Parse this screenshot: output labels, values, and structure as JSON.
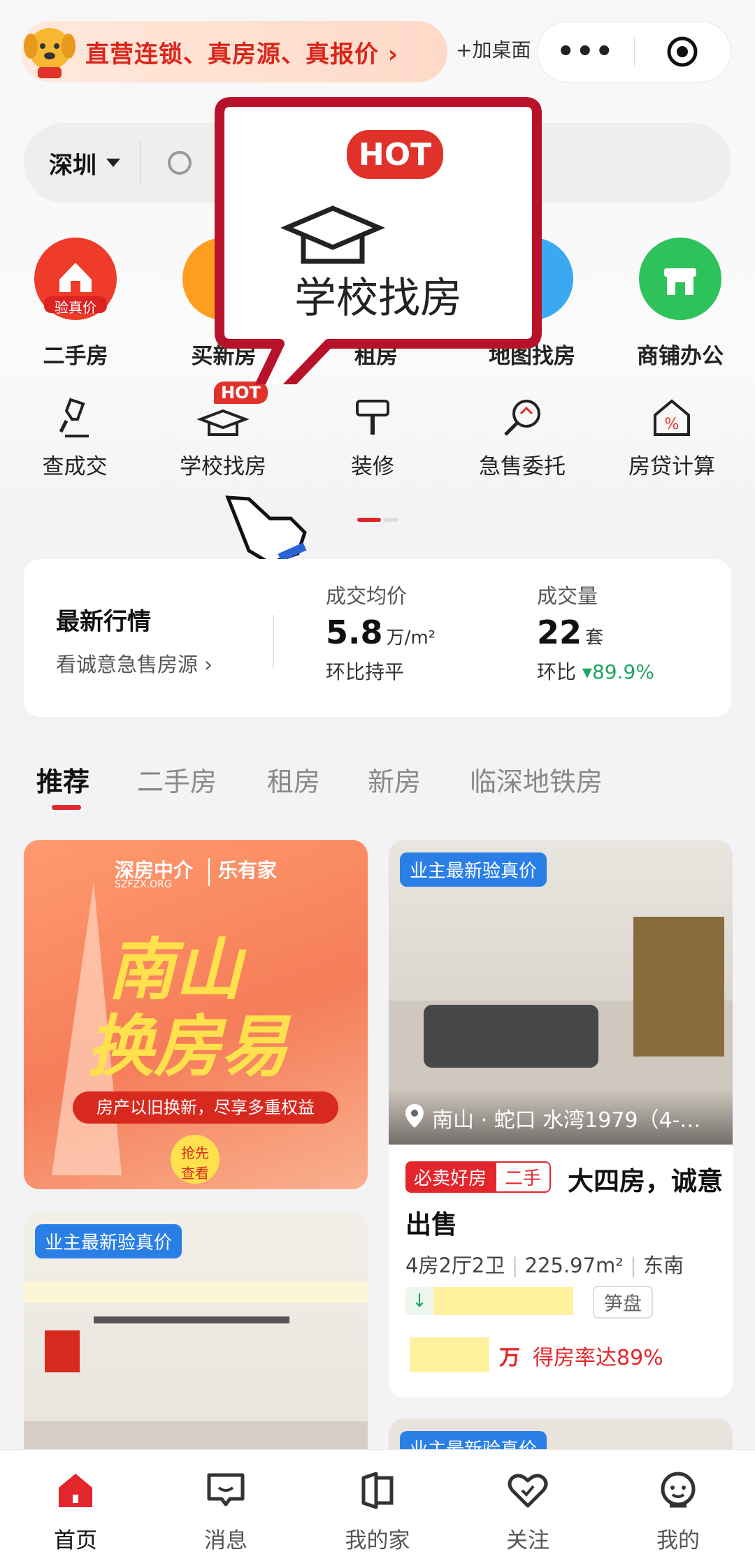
{
  "header": {
    "banner_text": "直营连锁、真房源、真报价 ›",
    "add_to_desktop": "+加桌面",
    "menu_dots": "•••"
  },
  "search": {
    "city": "深圳"
  },
  "categories_primary": [
    {
      "label": "二手房",
      "icon": "house-icon",
      "badge": "验真价",
      "color": "#ee3b2a"
    },
    {
      "label": "买新房",
      "icon": "building-icon",
      "color": "#ff9d1f"
    },
    {
      "label": "租房",
      "icon": "key-icon",
      "color": "#3a8ef5"
    },
    {
      "label": "地图找房",
      "icon": "map-pin-icon",
      "color": "#3aa9f2"
    },
    {
      "label": "商铺办公",
      "icon": "shop-icon",
      "color": "#2ec25a"
    }
  ],
  "categories_secondary": [
    {
      "label": "查成交",
      "icon": "stamp-icon"
    },
    {
      "label": "学校找房",
      "icon": "graduation-cap-icon",
      "badge": "HOT"
    },
    {
      "label": "装修",
      "icon": "paint-roller-icon"
    },
    {
      "label": "急售委托",
      "icon": "sale-tag-icon"
    },
    {
      "label": "房贷计算",
      "icon": "percent-house-icon"
    }
  ],
  "callout": {
    "label": "学校找房",
    "badge": "HOT"
  },
  "market": {
    "title": "最新行情",
    "link": "看诚意急售房源 ›",
    "avg_price_label": "成交均价",
    "avg_price_value": "5.8",
    "avg_price_unit": "万/m²",
    "avg_price_change": "环比持平",
    "volume_label": "成交量",
    "volume_value": "22",
    "volume_unit": "套",
    "volume_change_prefix": "环比",
    "volume_change": "▾89.9%"
  },
  "tabs": [
    "推荐",
    "二手房",
    "租房",
    "新房",
    "临深地铁房"
  ],
  "feed": {
    "promo": {
      "brand_left": "深房中介",
      "brand_left_sub": "SZFZX.ORG",
      "brand_right": "乐有家",
      "headline_1": "南山",
      "headline_2": "换房易",
      "subline": "房产以旧换新，尽享多重权益",
      "cta_1": "抢先",
      "cta_2": "查看"
    },
    "listing": {
      "tag": "业主最新验真价",
      "location": "南山 · 蛇口 水湾1979（4-…",
      "badge_red": "必卖好房",
      "badge_outline": "二手",
      "title": "大四房，诚意出售",
      "specs": [
        "4房2厅2卫",
        "225.97m²",
        "东南"
      ],
      "chip": "笋盘",
      "price_unit": "万",
      "rate": "得房率达89%"
    },
    "card3_tag": "业主最新验真价",
    "card4_tag": "业主最新验真价"
  },
  "bottom_nav": [
    {
      "label": "首页",
      "icon": "home-icon",
      "active": true
    },
    {
      "label": "消息",
      "icon": "message-icon"
    },
    {
      "label": "我的家",
      "icon": "my-home-icon"
    },
    {
      "label": "关注",
      "icon": "heart-check-icon"
    },
    {
      "label": "我的",
      "icon": "profile-icon"
    }
  ],
  "colors": {
    "accent": "#e3262b",
    "tag_blue": "#2a7fe6",
    "down_green": "#1fa463"
  }
}
